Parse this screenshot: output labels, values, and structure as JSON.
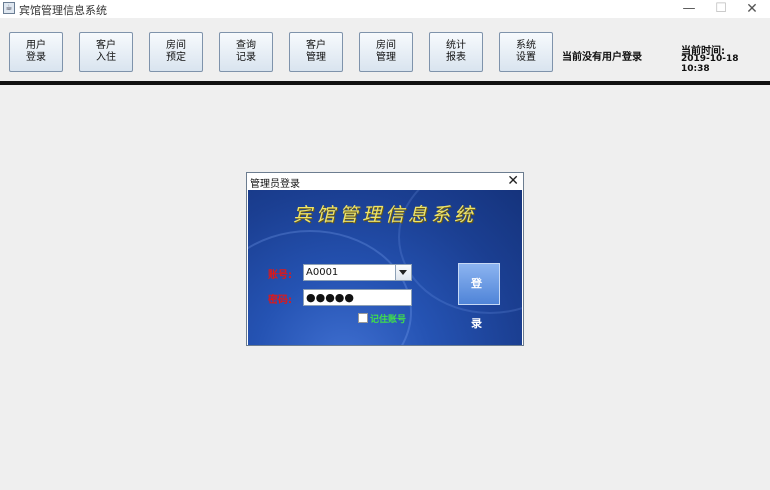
{
  "window": {
    "title": "宾馆管理信息系统",
    "min": "—",
    "max": "☐",
    "close": "✕"
  },
  "toolbar": {
    "buttons": [
      {
        "line1": "用户",
        "line2": "登录"
      },
      {
        "line1": "客户",
        "line2": "入住"
      },
      {
        "line1": "房间",
        "line2": "预定"
      },
      {
        "line1": "查询",
        "line2": "记录"
      },
      {
        "line1": "客户",
        "line2": "管理"
      },
      {
        "line1": "房间",
        "line2": "管理"
      },
      {
        "line1": "统计",
        "line2": "报表"
      },
      {
        "line1": "系统",
        "line2": "设置"
      }
    ],
    "status_user": "当前没有用户登录",
    "time_label": "当前时间:",
    "time_value": "2019-10-18 10:38"
  },
  "dialog": {
    "title": "管理员登录",
    "close": "✕",
    "banner": "宾馆管理信息系统",
    "account_label": "账号:",
    "account_value": "A0001",
    "password_label": "密码:",
    "password_value": "●●●●●",
    "remember_label": "记住账号",
    "login_label": "登 录"
  },
  "colors": {
    "label_red": "#e01818",
    "remember_green": "#41e04a",
    "banner_yellow": "#eee46a",
    "panel_blue": "#1b3f92"
  },
  "icons": {
    "app": "java-app-icon",
    "dropdown": "chevron-down-icon",
    "close": "close-icon"
  }
}
